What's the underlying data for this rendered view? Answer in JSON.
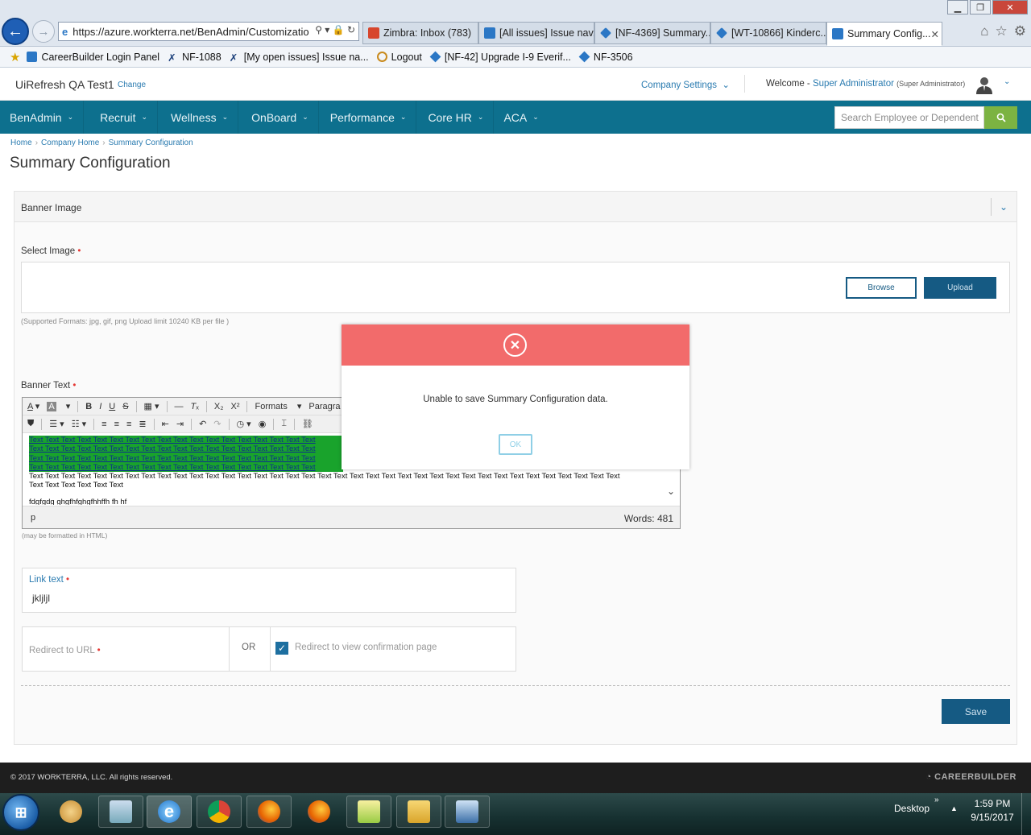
{
  "browser": {
    "address": "https://azure.workterra.net/BenAdmin/Customizatio",
    "tabs": [
      {
        "label": "Zimbra: Inbox (783)",
        "color": "#d7462d"
      },
      {
        "label": "[All issues] Issue nav...",
        "color": "#2b77c5"
      },
      {
        "label": "[NF-4369] Summary...",
        "color": "#2b77c5"
      },
      {
        "label": "[WT-10866] Kinderc...",
        "color": "#2b77c5"
      },
      {
        "label": "Summary Config...",
        "color": "#2b77c5",
        "active": true
      }
    ],
    "favorites": [
      {
        "label": "CareerBuilder Login Panel"
      },
      {
        "label": "NF-1088"
      },
      {
        "label": "[My open issues] Issue na..."
      },
      {
        "label": "Logout"
      },
      {
        "label": "[NF-42] Upgrade I-9 Everif..."
      },
      {
        "label": "NF-3506"
      }
    ]
  },
  "header": {
    "company": "UiRefresh QA Test1",
    "change": "Change",
    "company_settings": "Company Settings",
    "welcome": "Welcome -",
    "user": "Super Administrator",
    "role": "(Super Administrator)"
  },
  "nav": {
    "items": [
      "BenAdmin",
      "Recruit",
      "Wellness",
      "OnBoard",
      "Performance",
      "Core HR",
      "ACA"
    ],
    "search_placeholder": "Search Employee or Dependent"
  },
  "breadcrumb": [
    "Home",
    "Company Home",
    "Summary Configuration"
  ],
  "page_title": "Summary Configuration",
  "panel": {
    "title": "Banner Image",
    "select_image_label": "Select Image",
    "browse": "Browse",
    "upload": "Upload",
    "formats_hint": "(Supported Formats: jpg, gif, png Upload limit 10240 KB per file )",
    "banner_text_label": "Banner Text",
    "toolbar_formats": "Formats",
    "toolbar_paragraph": "Paragra",
    "editor_plain_line1": "Text Text Text Text Text Text Text Text Text Text Text Text Text Text Text Text Text Text Text Text Text Text Text Text Text Text Text Text Text Text Text Text Text Text Text Text Text",
    "editor_plain_line2": "Text Text Text Text Text Text",
    "editor_last_line": "fdgfgdg ghgfhfghgfhhffh fh hf",
    "editor_green_line": "Text Text Text Text Text Text Text Text Text Text Text Text Text Text Text Text Text Text",
    "editor_path": "p",
    "word_count": "Words: 481",
    "html_hint": "(may be formatted in HTML)",
    "link_text_label": "Link text",
    "link_text_value": "jkljljl",
    "redirect_url_label": "Redirect to URL",
    "or_label": "OR",
    "redirect_confirm_label": "Redirect to view confirmation page",
    "save": "Save"
  },
  "modal": {
    "message": "Unable to save Summary Configuration data.",
    "ok": "OK",
    "header_color": "#f26b6b"
  },
  "footer": {
    "copyright": "© 2017 WORKTERRA, LLC. All rights reserved.",
    "brand": "CAREERBUILDER"
  },
  "taskbar": {
    "desktop": "Desktop",
    "time": "1:59 PM",
    "date": "9/15/2017"
  }
}
